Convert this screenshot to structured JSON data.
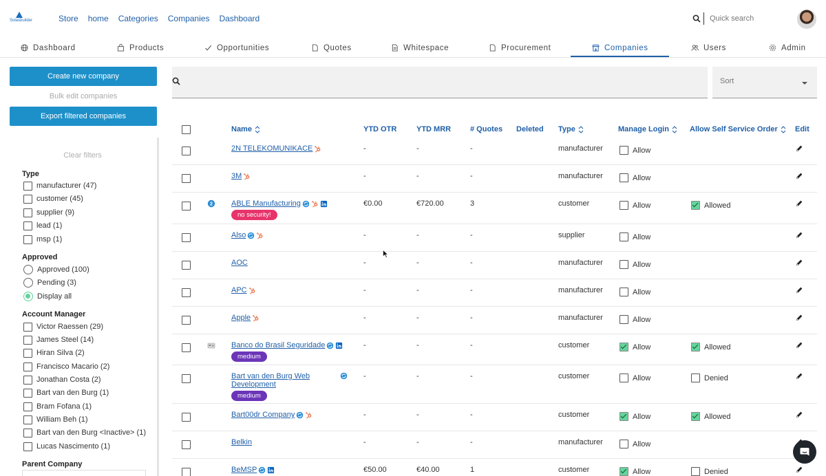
{
  "brand": {
    "logo_text": "Solasbuilder"
  },
  "topnav": [
    "Store",
    "home",
    "Categories",
    "Companies",
    "Dashboard"
  ],
  "quick_search": {
    "placeholder": "Quick search"
  },
  "tabs": [
    {
      "label": "Dashboard",
      "icon": "globe-icon"
    },
    {
      "label": "Products",
      "icon": "bag-icon"
    },
    {
      "label": "Opportunities",
      "icon": "check-icon"
    },
    {
      "label": "Quotes",
      "icon": "file-icon"
    },
    {
      "label": "Whitespace",
      "icon": "document-icon"
    },
    {
      "label": "Procurement",
      "icon": "file-icon"
    },
    {
      "label": "Companies",
      "icon": "store-icon",
      "active": true
    },
    {
      "label": "Users",
      "icon": "users-icon"
    },
    {
      "label": "Admin",
      "icon": "gear-icon"
    }
  ],
  "sidebar": {
    "create_label": "Create new company",
    "bulk_label": "Bulk edit companies",
    "export_label": "Export filtered companies",
    "clear_filters": "Clear filters",
    "type": {
      "title": "Type",
      "options": [
        "manufacturer (47)",
        "customer (45)",
        "supplier (9)",
        "lead (1)",
        "msp (1)"
      ]
    },
    "approved": {
      "title": "Approved",
      "options": [
        "Approved (100)",
        "Pending (3)",
        "Display all"
      ],
      "selected": 2
    },
    "account_manager": {
      "title": "Account Manager",
      "options": [
        "Victor Raessen (29)",
        "James Steel (14)",
        "Hiran Silva (2)",
        "Francisco Macario (2)",
        "Jonathan Costa (2)",
        "Bart van den Burg (1)",
        "Bram Fofana (1)",
        "William Beh (1)",
        "Bart van den Burg <Inactive> (1)",
        "Lucas Nascimento (1)"
      ]
    },
    "parent_company": {
      "title": "Parent Company"
    }
  },
  "search": {
    "placeholder": ""
  },
  "sort": {
    "label": "Sort"
  },
  "columns": {
    "name": "Name",
    "ytd_otr": "YTD OTR",
    "ytd_mrr": "YTD MRR",
    "quotes": "# Quotes",
    "deleted": "Deleted",
    "type": "Type",
    "manage_login": "Manage Login",
    "self_service": "Allow Self Service Order",
    "edit": "Edit"
  },
  "rows": [
    {
      "name": [
        "2N TELEKOMUNIKACE"
      ],
      "icons": [
        "hubspot-icon"
      ],
      "otr": "-",
      "mrr": "-",
      "quotes": "-",
      "type": "manufacturer",
      "login": false,
      "login_label": "Allow",
      "self": null
    },
    {
      "name": [
        "3M"
      ],
      "icons": [
        "hubspot-icon"
      ],
      "otr": "-",
      "mrr": "-",
      "quotes": "-",
      "type": "manufacturer",
      "login": false,
      "login_label": "Allow",
      "self": null
    },
    {
      "name": [
        "ABLE Manufacturing"
      ],
      "icons": [
        "sync-icon",
        "hubspot-icon",
        "linkedin-icon"
      ],
      "status_icon": "info-icon",
      "otr": "€0.00",
      "mrr": "€720.00",
      "quotes": "3",
      "type": "customer",
      "login": false,
      "login_label": "Allow",
      "self": true,
      "self_label": "Allowed",
      "badge": {
        "text": "no security!",
        "color": "#e8336b"
      }
    },
    {
      "name": [
        "Also"
      ],
      "icons": [
        "sync-icon",
        "hubspot-icon"
      ],
      "otr": "-",
      "mrr": "-",
      "quotes": "-",
      "type": "supplier",
      "login": false,
      "login_label": "Allow",
      "self": null
    },
    {
      "name": [
        "AOC"
      ],
      "icons": [],
      "otr": "-",
      "mrr": "-",
      "quotes": "-",
      "type": "manufacturer",
      "login": false,
      "login_label": "Allow",
      "self": null
    },
    {
      "name": [
        "APC"
      ],
      "icons": [
        "hubspot-icon"
      ],
      "otr": "-",
      "mrr": "-",
      "quotes": "-",
      "type": "manufacturer",
      "login": false,
      "login_label": "Allow",
      "self": null
    },
    {
      "name": [
        "Apple"
      ],
      "icons": [
        "hubspot-icon"
      ],
      "otr": "-",
      "mrr": "-",
      "quotes": "-",
      "type": "manufacturer",
      "login": false,
      "login_label": "Allow",
      "self": null
    },
    {
      "name": [
        "Banco do Brasil Seguridade"
      ],
      "icons": [
        "sync-icon",
        "linkedin-icon"
      ],
      "status_icon": "bank-icon",
      "otr": "-",
      "mrr": "-",
      "quotes": "-",
      "type": "customer",
      "login": true,
      "login_label": "Allow",
      "self": true,
      "self_label": "Allowed",
      "badge": {
        "text": "medium",
        "color": "#6b35b8"
      }
    },
    {
      "name": [
        "Bart van den Burg Web",
        "Development"
      ],
      "icons": [
        "sync-icon"
      ],
      "otr": "-",
      "mrr": "-",
      "quotes": "-",
      "type": "customer",
      "login": false,
      "login_label": "Allow",
      "self": false,
      "self_label": "Denied",
      "badge": {
        "text": "medium",
        "color": "#6b35b8"
      }
    },
    {
      "name": [
        "Bart00dr Company"
      ],
      "icons": [
        "sync-icon",
        "hubspot-icon"
      ],
      "otr": "-",
      "mrr": "-",
      "quotes": "-",
      "type": "customer",
      "login": true,
      "login_label": "Allow",
      "self": true,
      "self_label": "Allowed"
    },
    {
      "name": [
        "Belkin"
      ],
      "icons": [],
      "otr": "-",
      "mrr": "-",
      "quotes": "-",
      "type": "manufacturer",
      "login": false,
      "login_label": "Allow",
      "self": null
    },
    {
      "name": [
        "BeMSP"
      ],
      "icons": [
        "sync-icon",
        "linkedin-icon"
      ],
      "otr": "€50.00",
      "mrr": "€40.00",
      "quotes": "1",
      "type": "customer",
      "login": true,
      "login_label": "Allow",
      "self": false,
      "self_label": "Denied"
    }
  ],
  "colors": {
    "primary": "#1e90c9",
    "link": "#1f5fa8",
    "check": "#65d49c"
  }
}
